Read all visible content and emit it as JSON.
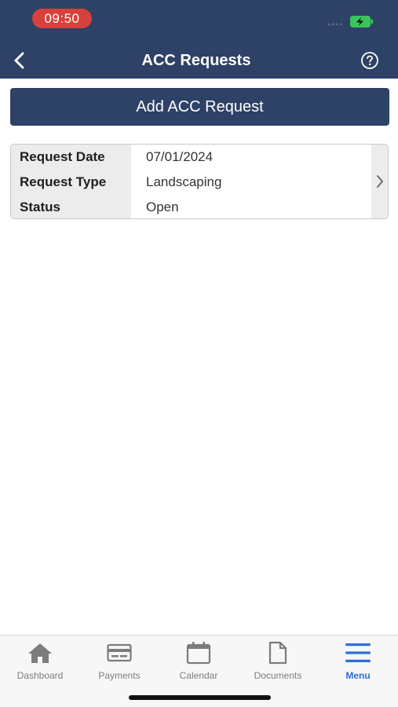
{
  "status_bar": {
    "time": "09:50"
  },
  "header": {
    "title": "ACC Requests"
  },
  "actions": {
    "add_label": "Add ACC Request"
  },
  "requests": [
    {
      "rows": [
        {
          "label": "Request Date",
          "value": "07/01/2024"
        },
        {
          "label": "Request Type",
          "value": "Landscaping"
        },
        {
          "label": "Status",
          "value": "Open"
        }
      ]
    }
  ],
  "tabs": [
    {
      "label": "Dashboard",
      "icon": "home-icon"
    },
    {
      "label": "Payments",
      "icon": "credit-card-icon"
    },
    {
      "label": "Calendar",
      "icon": "calendar-icon"
    },
    {
      "label": "Documents",
      "icon": "document-icon"
    },
    {
      "label": "Menu",
      "icon": "hamburger-menu-icon",
      "active": true
    }
  ],
  "colors": {
    "header_bg": "#2e4166",
    "time_pill": "#d8413b",
    "battery_green": "#35c759",
    "active_tab": "#2f6fd6",
    "inactive_tab": "#7c7c7c"
  }
}
